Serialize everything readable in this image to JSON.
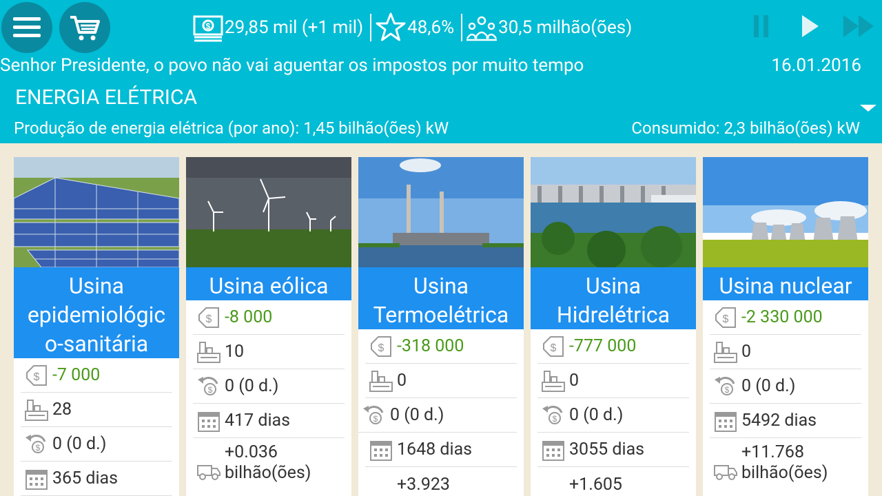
{
  "header": {
    "menu_icon": "hamburger-menu-icon",
    "cart_icon": "shopping-cart-icon",
    "money": "29,85 mil (+1 mil)",
    "rating": "48,6%",
    "population": "30,5 milhão(ões)",
    "controls": [
      "pause-icon",
      "play-icon",
      "fast-forward-icon"
    ]
  },
  "message": "Senhor Presidente, o povo não vai aguentar os impostos por muito tempo",
  "date": "16.01.2016",
  "section": {
    "title": "ENERGIA ELÉTRICA",
    "production": "Produção de energia elétrica (por ano): 1,45 bilhão(ões) kW",
    "consumed": "Consumido: 2,3 bilhão(ões) kW"
  },
  "colors": {
    "topbar": "#00bcd4",
    "title_band": "#1e90f0",
    "positive": "#4a9a1a",
    "background": "#f2ead8"
  },
  "cards": [
    {
      "name": "Usina epidemiológic o-sanitária",
      "title_lines": [
        "Usina",
        "epidemiológic",
        "o-sanitária"
      ],
      "cost": "-7 000",
      "count": "28",
      "income": "0 (0 d.)",
      "days": "365 dias",
      "production": ""
    },
    {
      "name": "Usina eólica",
      "title_lines": [
        "Usina eólica"
      ],
      "cost": "-8 000",
      "count": "10",
      "income": "0 (0 d.)",
      "days": "417 dias",
      "production": "+0.036",
      "production_unit": "bilhão(ões)"
    },
    {
      "name": "Usina Termoelétrica",
      "title_lines": [
        "Usina",
        "Termoelétrica"
      ],
      "cost": "-318 000",
      "count": "0",
      "income": "0 (0 d.)",
      "days": "1648 dias",
      "production": "+3.923"
    },
    {
      "name": "Usina Hidrelétrica",
      "title_lines": [
        "Usina",
        "Hidrelétrica"
      ],
      "cost": "-777 000",
      "count": "0",
      "income": "0 (0 d.)",
      "days": "3055 dias",
      "production": "+1.605"
    },
    {
      "name": "Usina nuclear",
      "title_lines": [
        "Usina nuclear"
      ],
      "cost": "-2 330 000",
      "count": "0",
      "income": "0 (0 d.)",
      "days": "5492 dias",
      "production": "+11.768",
      "production_unit": "bilhão(ões)"
    }
  ]
}
